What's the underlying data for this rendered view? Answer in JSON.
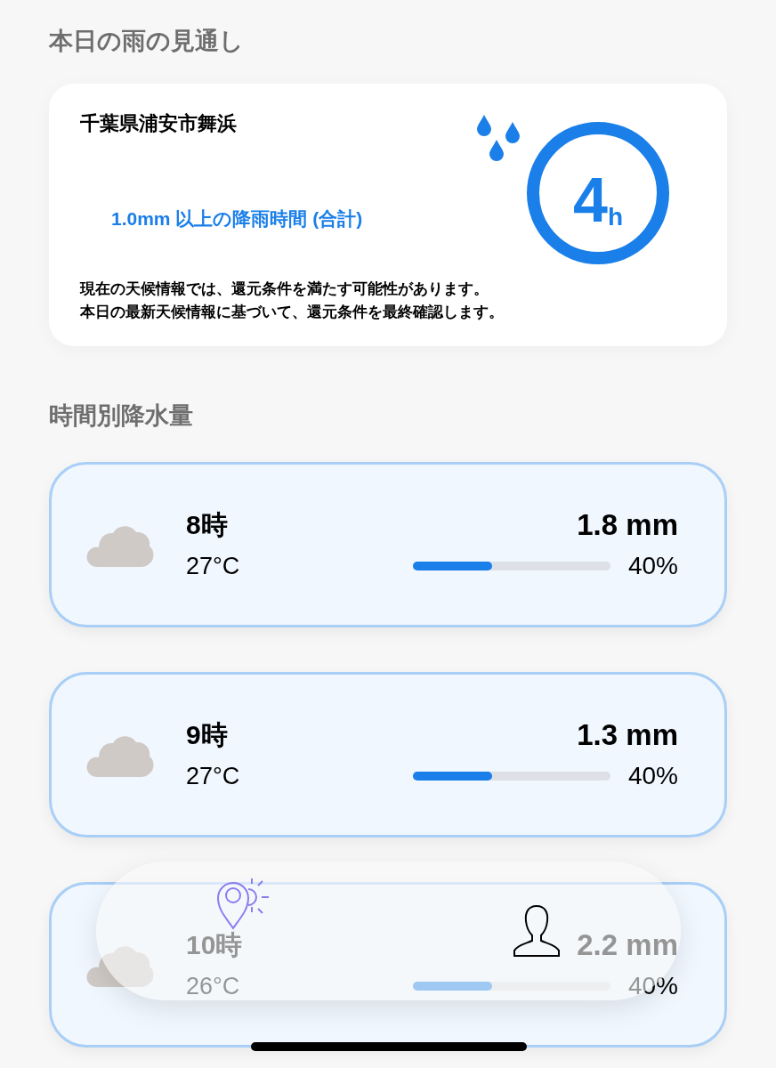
{
  "outlook": {
    "heading": "本日の雨の見通し",
    "location": "千葉県浦安市舞浜",
    "rain_label": "1.0mm 以上の降雨時間 (合計)",
    "hours_value": "4",
    "hours_unit": "h",
    "notes": [
      "現在の天候情報では、還元条件を満たす可能性があります。",
      "本日の最新天候情報に基づいて、還元条件を最終確認します。"
    ]
  },
  "hourly": {
    "heading": "時間別降水量",
    "rows": [
      {
        "hour": "8時",
        "temp": "27°C",
        "amount": "1.8 mm",
        "level": 0.4,
        "chance": "40%"
      },
      {
        "hour": "9時",
        "temp": "27°C",
        "amount": "1.3 mm",
        "level": 0.4,
        "chance": "40%"
      },
      {
        "hour": "10時",
        "temp": "26°C",
        "amount": "2.2 mm",
        "level": 0.4,
        "chance": "40%"
      }
    ]
  },
  "tab_bar": {
    "tabs": [
      {
        "kind": "weather-location",
        "selected": true
      },
      {
        "kind": "profile",
        "selected": false
      }
    ]
  }
}
